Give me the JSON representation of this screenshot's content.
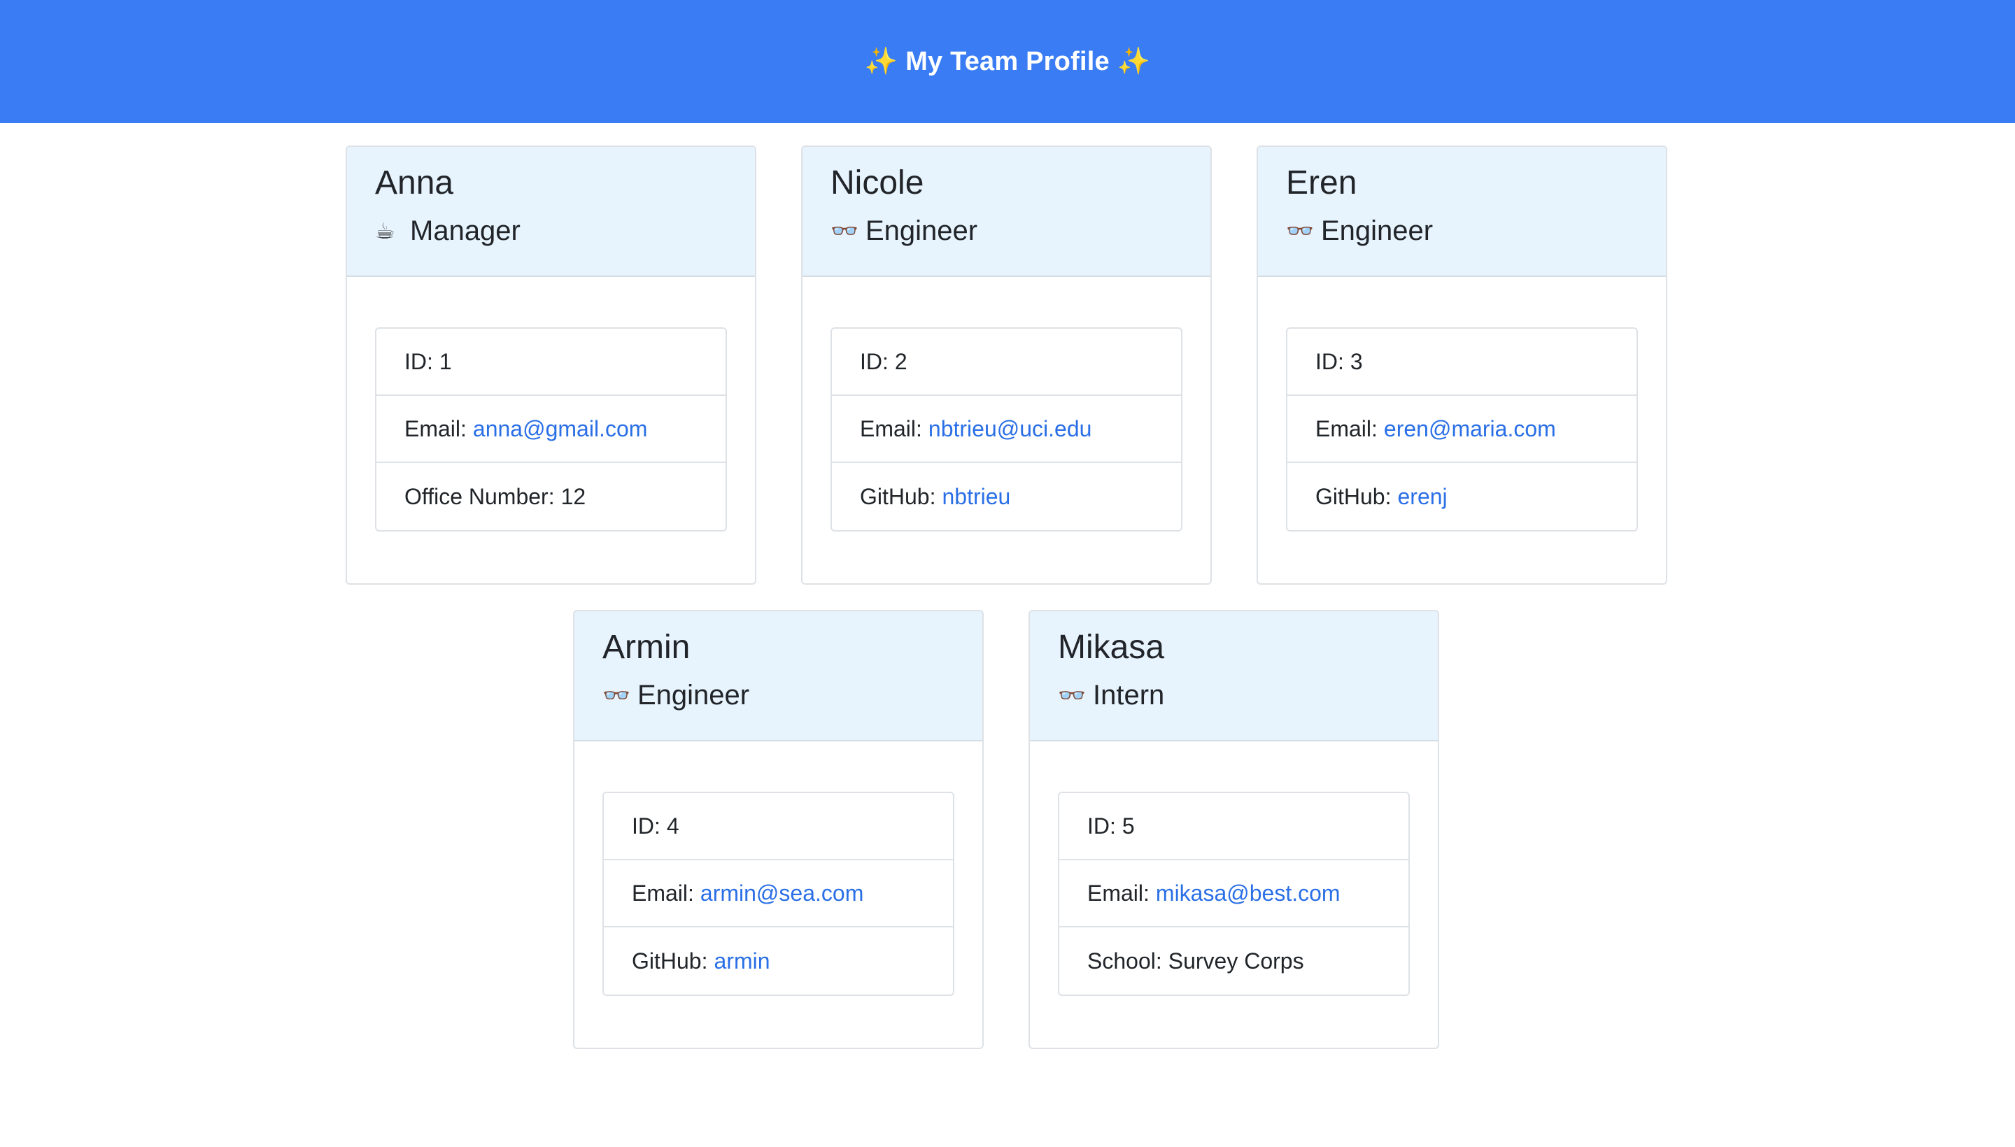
{
  "header": {
    "sparkle_left": "✨",
    "title": "My Team Profile",
    "sparkle_right": "✨"
  },
  "colors": {
    "header_bg": "#3a7cf4",
    "card_header_bg": "#e7f3fd",
    "link": "#2a6fe6"
  },
  "team": [
    {
      "name": "Anna",
      "role_icon": "coffee-icon",
      "role_glyph": "☕",
      "role": "Manager",
      "id_label": "ID:",
      "id": "1",
      "email_label": "Email:",
      "email": "anna@gmail.com",
      "extra_label": "Office Number:",
      "extra": "12"
    },
    {
      "name": "Nicole",
      "role_icon": "glasses-icon",
      "role_glyph": "👓",
      "role": "Engineer",
      "id_label": "ID:",
      "id": "2",
      "email_label": "Email:",
      "email": "nbtrieu@uci.edu",
      "extra_label": "GitHub:",
      "extra": "nbtrieu"
    },
    {
      "name": "Eren",
      "role_icon": "glasses-icon",
      "role_glyph": "👓",
      "role": "Engineer",
      "id_label": "ID:",
      "id": "3",
      "email_label": "Email:",
      "email": "eren@maria.com",
      "extra_label": "GitHub:",
      "extra": "erenj"
    },
    {
      "name": "Armin",
      "role_icon": "glasses-icon",
      "role_glyph": "👓",
      "role": "Engineer",
      "id_label": "ID:",
      "id": "4",
      "email_label": "Email:",
      "email": "armin@sea.com",
      "extra_label": "GitHub:",
      "extra": "armin"
    },
    {
      "name": "Mikasa",
      "role_icon": "glasses-icon",
      "role_glyph": "👓",
      "role": "Intern",
      "id_label": "ID:",
      "id": "5",
      "email_label": "Email:",
      "email": "mikasa@best.com",
      "extra_label": "School:",
      "extra": "Survey Corps"
    }
  ]
}
